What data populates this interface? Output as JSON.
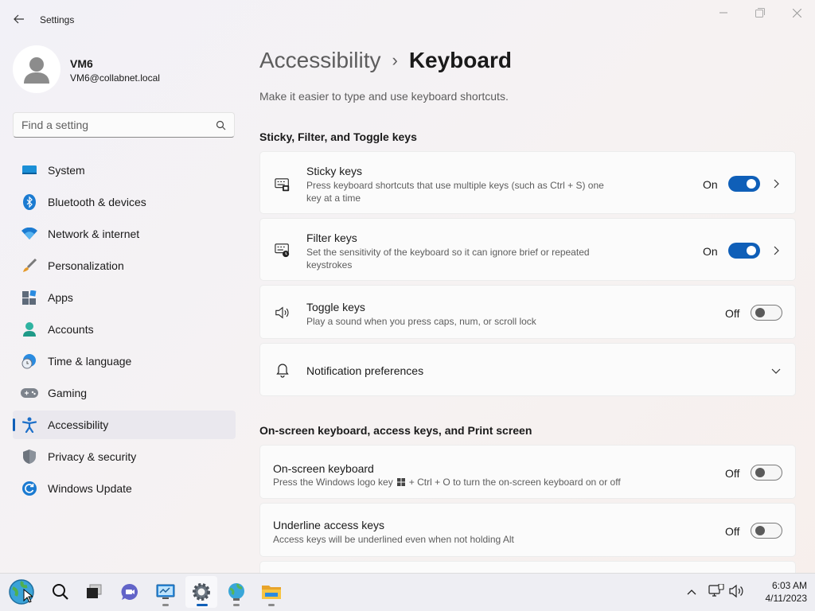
{
  "window": {
    "title": "Settings"
  },
  "user": {
    "name": "VM6",
    "email": "VM6@collabnet.local"
  },
  "search": {
    "placeholder": "Find a setting"
  },
  "nav": [
    {
      "label": "System",
      "icon": "system-icon"
    },
    {
      "label": "Bluetooth & devices",
      "icon": "bluetooth-icon"
    },
    {
      "label": "Network & internet",
      "icon": "wifi-icon"
    },
    {
      "label": "Personalization",
      "icon": "brush-icon"
    },
    {
      "label": "Apps",
      "icon": "apps-icon"
    },
    {
      "label": "Accounts",
      "icon": "person-icon"
    },
    {
      "label": "Time & language",
      "icon": "globe-clock-icon"
    },
    {
      "label": "Gaming",
      "icon": "gamepad-icon"
    },
    {
      "label": "Accessibility",
      "icon": "accessibility-icon",
      "selected": true
    },
    {
      "label": "Privacy & security",
      "icon": "shield-icon"
    },
    {
      "label": "Windows Update",
      "icon": "update-icon"
    }
  ],
  "breadcrumb": {
    "parent": "Accessibility",
    "separator": "›",
    "current": "Keyboard"
  },
  "page": {
    "subtitle": "Make it easier to type and use keyboard shortcuts."
  },
  "sections": {
    "sticky_filter_toggle": "Sticky, Filter, and Toggle keys",
    "onscreen": "On-screen keyboard, access keys, and Print screen"
  },
  "settings": {
    "sticky": {
      "title": "Sticky keys",
      "desc1": "Press keyboard shortcuts that use multiple keys (such as Ctrl + S) one",
      "desc2": "key at a time",
      "state": "On"
    },
    "filter": {
      "title": "Filter keys",
      "desc1": "Set the sensitivity of the keyboard so it can ignore brief or repeated",
      "desc2": "keystrokes",
      "state": "On"
    },
    "toggle": {
      "title": "Toggle keys",
      "desc": "Play a sound when you press caps, num, or scroll lock",
      "state": "Off"
    },
    "notif": {
      "title": "Notification preferences"
    },
    "osk": {
      "title": "On-screen keyboard",
      "desc_a": "Press the Windows logo key",
      "desc_b": "+ Ctrl + O to turn the on-screen keyboard on or off",
      "state": "Off"
    },
    "underline": {
      "title": "Underline access keys",
      "desc": "Access keys will be underlined even when not holding Alt",
      "state": "Off"
    }
  },
  "tray": {
    "time": "6:03 AM",
    "date": "4/11/2023"
  },
  "colors": {
    "accent": "#0f5fb8"
  }
}
